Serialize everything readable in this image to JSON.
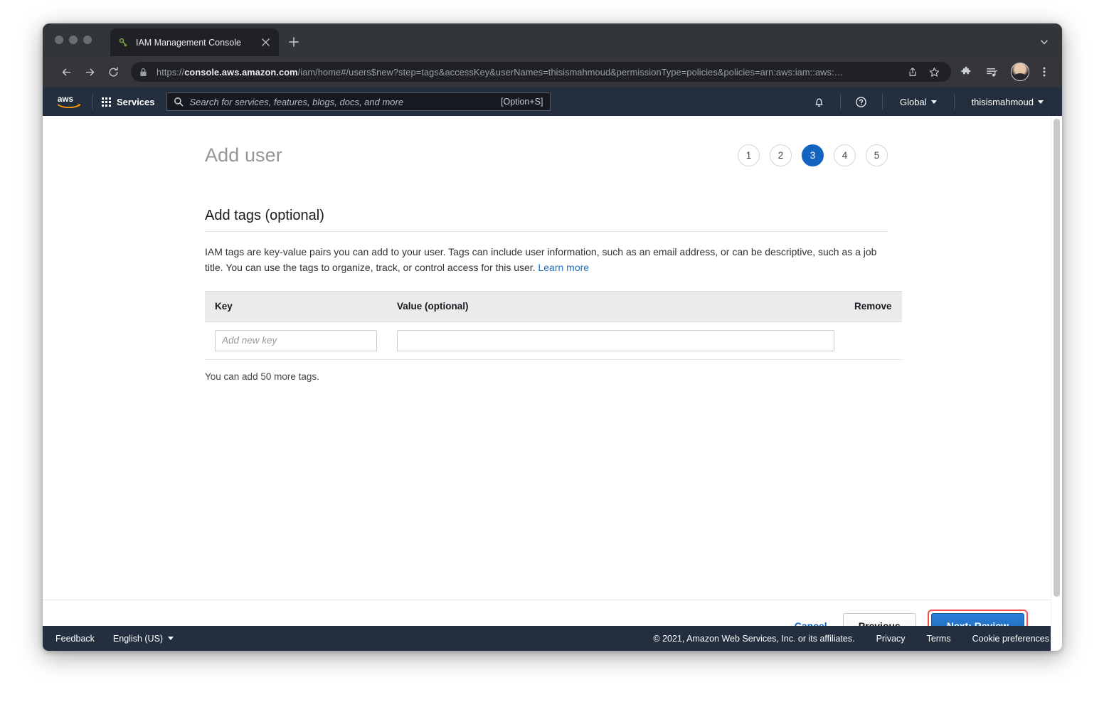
{
  "browser": {
    "tab": {
      "title": "IAM Management Console",
      "favicon": "key-icon",
      "close_label": "✕"
    },
    "new_tab_label": "+",
    "tab_list_chevron": "chevron-down-icon",
    "toolbar": {
      "back": "back-arrow-icon",
      "forward": "forward-arrow-icon",
      "reload": "reload-icon",
      "lock": "lock-icon",
      "url_scheme": "https://",
      "url_host": "console.aws.amazon.com",
      "url_path": "/iam/home#/users$new?step=tags&accessKey&userNames=thisismahmoud&permissionType=policies&policies=arn:aws:iam::aws:…",
      "share": "share-icon",
      "bookmark": "star-icon",
      "extensions": "puzzle-piece-icon",
      "reading_list": "reading-list-icon",
      "profile": "avatar-icon",
      "menu": "three-dot-menu-icon"
    }
  },
  "aws_nav": {
    "logo": "aws-logo",
    "services_label": "Services",
    "search": {
      "icon": "search-icon",
      "placeholder": "Search for services, features, blogs, docs, and more",
      "value": "",
      "shortcut": "[Option+S]"
    },
    "notifications_icon": "bell-icon",
    "help_icon": "question-circle-icon",
    "region_label": "Global",
    "account_label": "thisismahmoud"
  },
  "page": {
    "title": "Add user",
    "steps": [
      {
        "number": "1",
        "active": false
      },
      {
        "number": "2",
        "active": false
      },
      {
        "number": "3",
        "active": true
      },
      {
        "number": "4",
        "active": false
      },
      {
        "number": "5",
        "active": false
      }
    ],
    "section_heading": "Add tags (optional)",
    "description_part1": "IAM tags are key-value pairs you can add to your user. Tags can include user information, such as an email address, or can be descriptive, such as a job title. You can use the tags to organize, track, or control access for this user. ",
    "learn_more_label": "Learn more",
    "table": {
      "headers": {
        "key": "Key",
        "value": "Value (optional)",
        "remove": "Remove"
      },
      "rows": [
        {
          "key_value": "",
          "key_placeholder": "Add new key",
          "value_value": "",
          "value_placeholder": ""
        }
      ]
    },
    "tags_remaining": "You can add 50 more tags."
  },
  "actions": {
    "cancel_label": "Cancel",
    "previous_label": "Previous",
    "next_label": "Next: Review",
    "next_highlight_color": "#fb4c50"
  },
  "footer": {
    "feedback_label": "Feedback",
    "language_label": "English (US)",
    "copyright": "© 2021, Amazon Web Services, Inc. or its affiliates.",
    "privacy_label": "Privacy",
    "terms_label": "Terms",
    "cookie_label": "Cookie preferences"
  },
  "colors": {
    "aws_navy": "#232f3e",
    "accent_blue": "#1264c0",
    "link_blue": "#1f6fc4",
    "highlight_red": "#fb4c50"
  }
}
